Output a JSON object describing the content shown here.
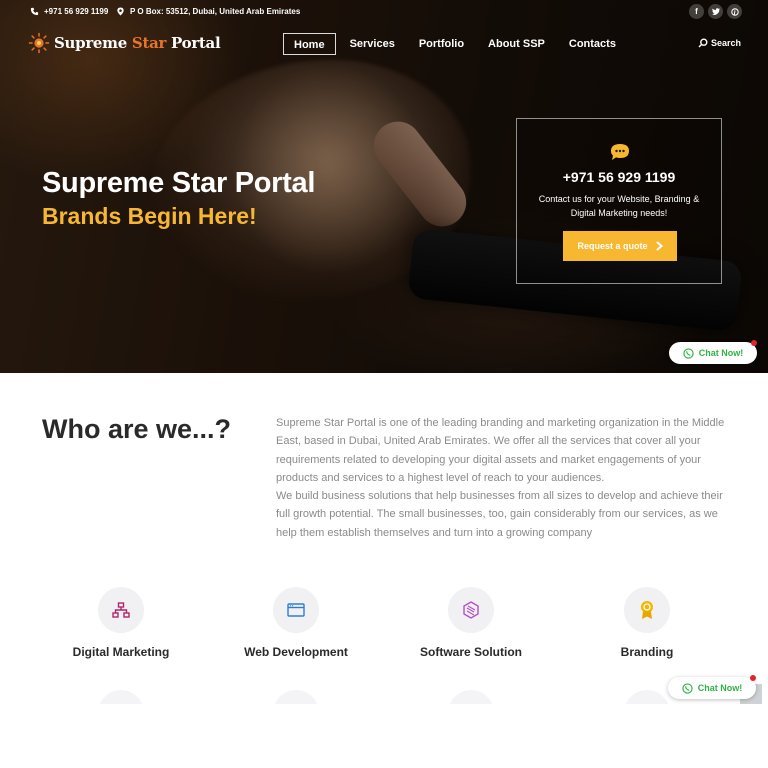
{
  "topbar": {
    "phone": "+971 56 929 1199",
    "address": "P O Box: 53512, Dubai, United Arab Emirates",
    "socials": [
      "facebook-icon",
      "twitter-icon",
      "pinterest-icon"
    ]
  },
  "brand": {
    "name_part1": "Supreme ",
    "name_part2": "Star ",
    "name_part3": "Portal",
    "accent_color": "#e8742a"
  },
  "nav": {
    "items": [
      "Home",
      "Services",
      "Portfolio",
      "About SSP",
      "Contacts"
    ],
    "active": "Home",
    "search_label": "Search"
  },
  "hero": {
    "title": "Supreme Star Portal",
    "subtitle": "Brands Begin Here!",
    "subtitle_color": "#f7b731"
  },
  "contact_box": {
    "phone": "+971 56 929 1199",
    "description": "Contact us for your Website, Branding & Digital Marketing needs!",
    "button_label": "Request a quote"
  },
  "chat": {
    "label": "Chat Now!"
  },
  "about": {
    "title": "Who are we...?",
    "paragraph1": "Supreme Star Portal is one of the leading branding and marketing organization in the Middle East, based in Dubai, United Arab Emirates. We offer all the services that cover all your requirements related to developing your digital assets and market engagements of your products and services to a highest level of reach to your audiences.",
    "paragraph2": "We build business solutions that help businesses from all sizes to develop and achieve their full growth potential. The small businesses, too, gain considerably from our services, as we help them establish themselves and turn into a growing company"
  },
  "services": [
    {
      "label": "Digital Marketing",
      "icon": "network-icon",
      "color": "#b0256a"
    },
    {
      "label": "Web Development",
      "icon": "browser-window-icon",
      "color": "#2a7fd4"
    },
    {
      "label": "Software Solution",
      "icon": "cube-stack-icon",
      "color": "#b34fc9"
    },
    {
      "label": "Branding",
      "icon": "award-badge-icon",
      "color": "#e6a700"
    }
  ]
}
